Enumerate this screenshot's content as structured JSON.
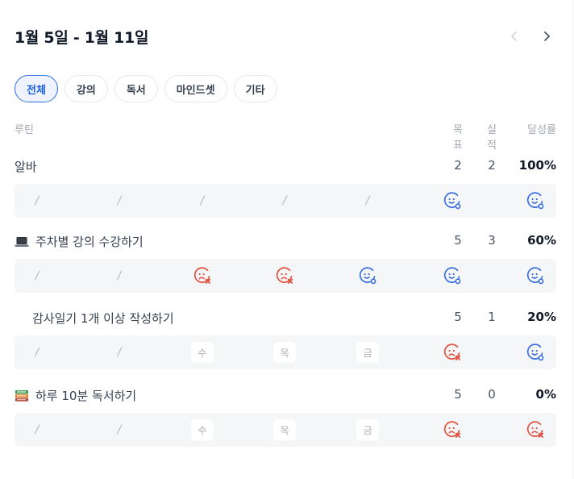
{
  "header": {
    "title": "1월 5일 - 1월 11일"
  },
  "tabs": [
    {
      "label": "전체",
      "active": true
    },
    {
      "label": "강의",
      "active": false
    },
    {
      "label": "독서",
      "active": false
    },
    {
      "label": "마인드셋",
      "active": false
    },
    {
      "label": "기타",
      "active": false
    }
  ],
  "columns": {
    "routine": "루틴",
    "goal": "목표",
    "actual": "실적",
    "rate": "달성률"
  },
  "routines": [
    {
      "name": "알바",
      "icon": null,
      "goal": "2",
      "actual": "2",
      "rate": "100%",
      "days": [
        {
          "type": "slash",
          "text": "/"
        },
        {
          "type": "slash",
          "text": "/"
        },
        {
          "type": "slash",
          "text": "/"
        },
        {
          "type": "slash",
          "text": "/"
        },
        {
          "type": "slash",
          "text": "/"
        },
        {
          "type": "success"
        },
        {
          "type": "success"
        }
      ]
    },
    {
      "name": "주차별 강의 수강하기",
      "icon": "laptop-icon",
      "goal": "5",
      "actual": "3",
      "rate": "60%",
      "days": [
        {
          "type": "slash",
          "text": "/"
        },
        {
          "type": "slash",
          "text": "/"
        },
        {
          "type": "fail"
        },
        {
          "type": "fail"
        },
        {
          "type": "success"
        },
        {
          "type": "success"
        },
        {
          "type": "success"
        }
      ]
    },
    {
      "name": "감사일기 1개 이상 작성하기",
      "icon": null,
      "goal": "5",
      "actual": "1",
      "rate": "20%",
      "days": [
        {
          "type": "slash",
          "text": "/"
        },
        {
          "type": "slash",
          "text": "/"
        },
        {
          "type": "day",
          "text": "수"
        },
        {
          "type": "day",
          "text": "목"
        },
        {
          "type": "day",
          "text": "금"
        },
        {
          "type": "fail"
        },
        {
          "type": "success"
        }
      ]
    },
    {
      "name": "하루 10분 독서하기",
      "icon": "books-icon",
      "goal": "5",
      "actual": "0",
      "rate": "0%",
      "days": [
        {
          "type": "slash",
          "text": "/"
        },
        {
          "type": "slash",
          "text": "/"
        },
        {
          "type": "day",
          "text": "수"
        },
        {
          "type": "day",
          "text": "목"
        },
        {
          "type": "day",
          "text": "금"
        },
        {
          "type": "fail"
        },
        {
          "type": "fail"
        }
      ]
    }
  ],
  "colors": {
    "success": "#3b6fe0",
    "fail": "#e0513f",
    "accent": "#2f6fe4"
  }
}
